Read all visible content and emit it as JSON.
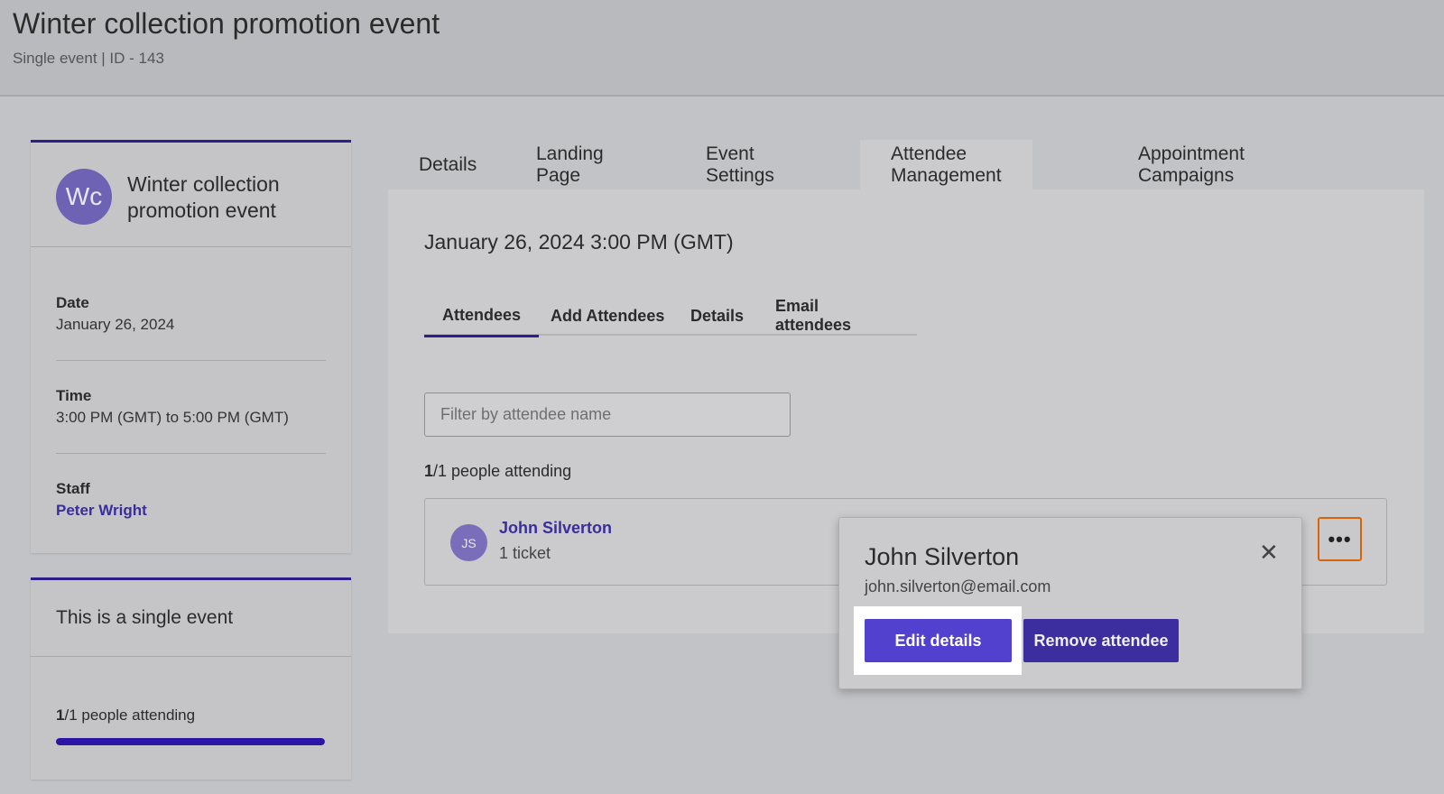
{
  "header": {
    "title": "Winter collection promotion event",
    "subtitle": "Single event | ID - 143"
  },
  "sidebar": {
    "avatar_initials": "Wc",
    "event_name": "Winter collection promotion event",
    "date_label": "Date",
    "date_value": "January 26, 2024",
    "time_label": "Time",
    "time_value": "3:00 PM (GMT) to 5:00 PM (GMT)",
    "staff_label": "Staff",
    "staff_value": "Peter Wright",
    "single_event_text": "This is a single event",
    "attending_bold": "1",
    "attending_rest": "/1 people attending",
    "attending_progress": 1.0
  },
  "tabs": [
    {
      "label": "Details"
    },
    {
      "label": "Landing Page"
    },
    {
      "label": "Event Settings"
    },
    {
      "label": "Attendee Management",
      "active": true
    },
    {
      "label": "Appointment Campaigns"
    }
  ],
  "panel": {
    "date_heading": "January 26, 2024 3:00 PM (GMT)",
    "subtabs": [
      {
        "label": "Attendees",
        "active": true
      },
      {
        "label": "Add Attendees"
      },
      {
        "label": "Details"
      },
      {
        "label": "Email attendees"
      }
    ],
    "filter_placeholder": "Filter by attendee name",
    "attending_bold": "1",
    "attending_rest": "/1 people attending"
  },
  "attendee": {
    "initials": "JS",
    "name": "John Silverton",
    "tickets": "1 ticket",
    "more_label": "•••"
  },
  "popover": {
    "name": "John Silverton",
    "email": "john.silverton@email.com",
    "close_glyph": "✕",
    "edit_label": "Edit details",
    "remove_label": "Remove attendee"
  },
  "colors": {
    "accent": "#2e1e8a",
    "link": "#3a2d9c",
    "edit_button": "#5240cf",
    "remove_button": "#3d2ea0",
    "focus_outline": "#d8640a"
  }
}
